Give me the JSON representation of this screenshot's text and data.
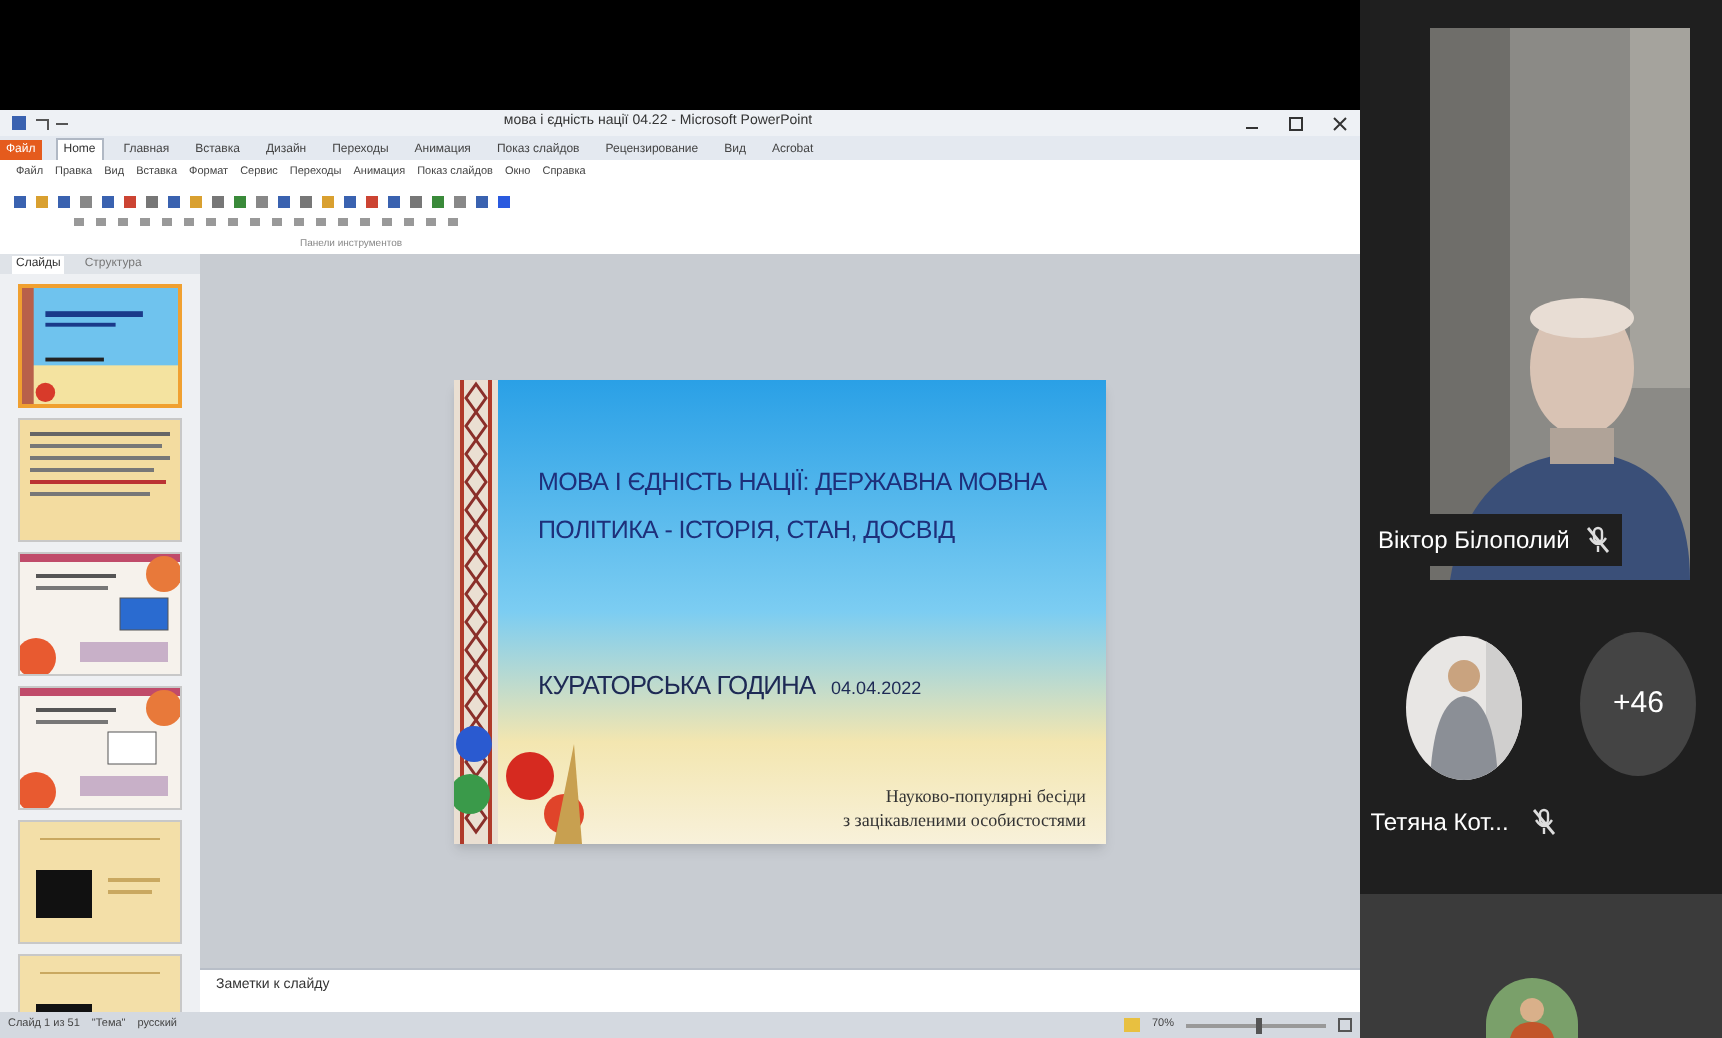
{
  "window": {
    "title": "мова і єдність нації 04.22 - Microsoft PowerPoint"
  },
  "ribbon": {
    "tabs": [
      {
        "label": "Файл",
        "kind": "file",
        "selected": false
      },
      {
        "label": "Home",
        "kind": "tab",
        "selected": true
      },
      {
        "label": "Главная",
        "kind": "tab",
        "selected": false
      },
      {
        "label": "Вставка",
        "kind": "tab",
        "selected": false
      },
      {
        "label": "Дизайн",
        "kind": "tab",
        "selected": false
      },
      {
        "label": "Переходы",
        "kind": "tab",
        "selected": false
      },
      {
        "label": "Анимация",
        "kind": "tab",
        "selected": false
      },
      {
        "label": "Показ слайдов",
        "kind": "tab",
        "selected": false
      },
      {
        "label": "Рецензирование",
        "kind": "tab",
        "selected": false
      },
      {
        "label": "Вид",
        "kind": "tab",
        "selected": false
      },
      {
        "label": "Acrobat",
        "kind": "tab",
        "selected": false
      }
    ],
    "menus": [
      "Файл",
      "Правка",
      "Вид",
      "Вставка",
      "Формат",
      "Сервис",
      "Переходы",
      "Анимация",
      "Показ слайдов",
      "Окно",
      "Справка"
    ],
    "group_label": "Панели инструментов"
  },
  "slides_pane": {
    "tabs": [
      {
        "label": "Слайды",
        "selected": true
      },
      {
        "label": "Структура",
        "selected": false
      }
    ],
    "thumbnails": [
      {
        "kind": "title",
        "selected": true
      },
      {
        "kind": "text",
        "selected": false
      },
      {
        "kind": "flowers",
        "selected": false
      },
      {
        "kind": "flowers",
        "selected": false
      },
      {
        "kind": "dark",
        "selected": false
      },
      {
        "kind": "dark",
        "selected": false
      }
    ]
  },
  "slide": {
    "title_lines": [
      "МОВА І ЄДНІСТЬ НАЦІЇ: ДЕРЖАВНА МОВНА",
      "ПОЛІТИКА - ІСТОРІЯ, СТАН, ДОСВІД"
    ],
    "event": "КУРАТОРСЬКА ГОДИНА",
    "date": "04.04.2022",
    "subtitle_lines": [
      "Науково-популярні бесіди",
      "з зацікавленими особистостями"
    ]
  },
  "notes": {
    "placeholder": "Заметки к слайду"
  },
  "status_bar": {
    "slide_info": "Слайд 1 из 51",
    "theme": "\"Тема\"",
    "language": "русский",
    "zoom": "70%",
    "level": 0.5
  },
  "participants": [
    {
      "kind": "video",
      "name": "Віктор Білополий",
      "muted": true
    },
    {
      "kind": "avatar",
      "name": "Тетяна Кот...",
      "muted": true
    },
    {
      "kind": "more",
      "count": "+46"
    },
    {
      "kind": "tile"
    }
  ]
}
